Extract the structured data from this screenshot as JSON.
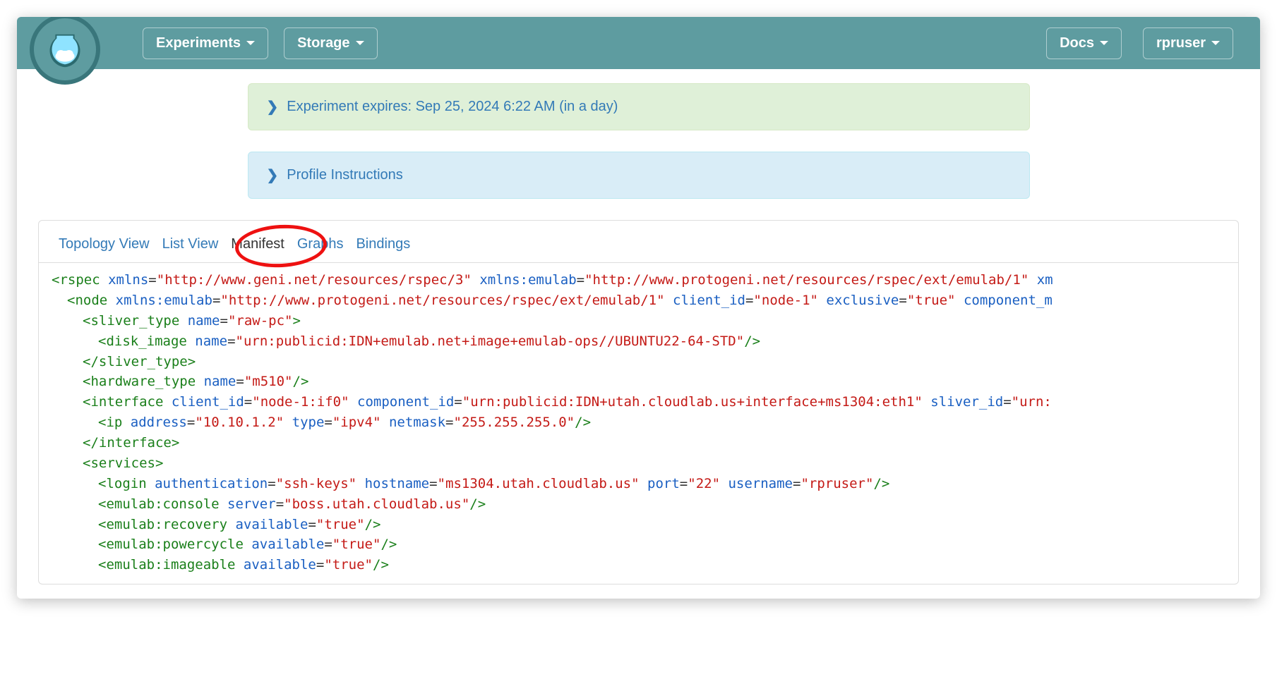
{
  "nav": {
    "experiments": "Experiments",
    "storage": "Storage",
    "docs": "Docs",
    "user": "rpruser"
  },
  "alerts": {
    "expires_label": "Experiment expires: ",
    "expires_time": "Sep 25, 2024 6:22 AM ",
    "expires_rel": "(in a day)",
    "profile_instructions": "Profile Instructions"
  },
  "tabs": {
    "topology": "Topology View",
    "list": "List View",
    "manifest": "Manifest",
    "graphs": "Graphs",
    "bindings": "Bindings"
  },
  "manifest": {
    "rspec_xmlns": "http://www.geni.net/resources/rspec/3",
    "rspec_xmlns_emulab": "http://www.protogeni.net/resources/rspec/ext/emulab/1",
    "node_xmlns_emulab": "http://www.protogeni.net/resources/rspec/ext/emulab/1",
    "node_client_id": "node-1",
    "node_exclusive": "true",
    "sliver_type_name": "raw-pc",
    "disk_image_name": "urn:publicid:IDN+emulab.net+image+emulab-ops//UBUNTU22-64-STD",
    "hardware_type_name": "m510",
    "interface_client_id": "node-1:if0",
    "interface_component_id": "urn:publicid:IDN+utah.cloudlab.us+interface+ms1304:eth1",
    "interface_sliver_id_prefix": "urn:",
    "ip_address": "10.10.1.2",
    "ip_type": "ipv4",
    "ip_netmask": "255.255.255.0",
    "login_authentication": "ssh-keys",
    "login_hostname": "ms1304.utah.cloudlab.us",
    "login_port": "22",
    "login_username": "rpruser",
    "console_server": "boss.utah.cloudlab.us",
    "recovery_available": "true",
    "powercycle_available": "true",
    "imageable_available": "true"
  }
}
